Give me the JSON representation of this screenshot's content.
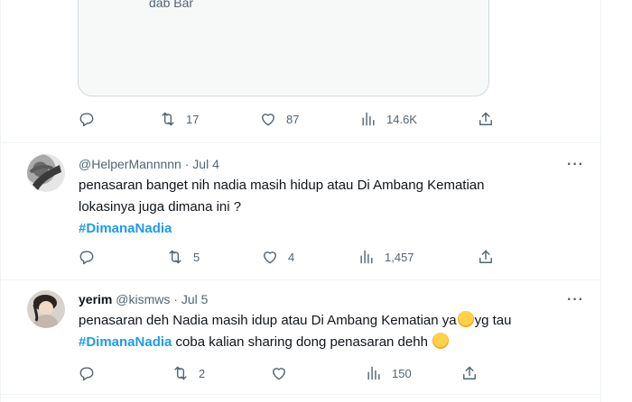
{
  "media_card": {
    "text": "dab Bar"
  },
  "tweets": [
    {
      "stats": {
        "replies": "",
        "retweets": "17",
        "likes": "87",
        "views": "14.6K"
      }
    },
    {
      "display_name": "",
      "handle": "@HelperMannnnn",
      "separator": "·",
      "date": "Jul 4",
      "lines": [
        "penasaran banget nih nadia masih hidup atau Di Ambang Kematian",
        "lokasinya juga dimana ini ?"
      ],
      "hashtag": "#DimanaNadia",
      "stats": {
        "replies": "",
        "retweets": "5",
        "likes": "4",
        "views": "1,457"
      }
    },
    {
      "display_name": "yerim",
      "handle": "@kismws",
      "separator": "·",
      "date": "Jul 5",
      "line1_before": "penasaran deh Nadia masih idup atau Di Ambang Kematian ya",
      "line1_after": "yg tau",
      "hashtag": "#DimanaNadia",
      "line2_after": " coba kalian sharing dong penasaran dehh",
      "stats": {
        "replies": "",
        "retweets": "2",
        "likes": "",
        "views": "150"
      }
    }
  ],
  "more_label": "···",
  "icons": [
    "reply-icon",
    "retweet-icon",
    "like-icon",
    "views-icon",
    "share-icon",
    "more-icon"
  ],
  "colors": {
    "hashtag": "#1d9bf0",
    "secondary_text": "#536471",
    "divider": "#eff3f4"
  }
}
